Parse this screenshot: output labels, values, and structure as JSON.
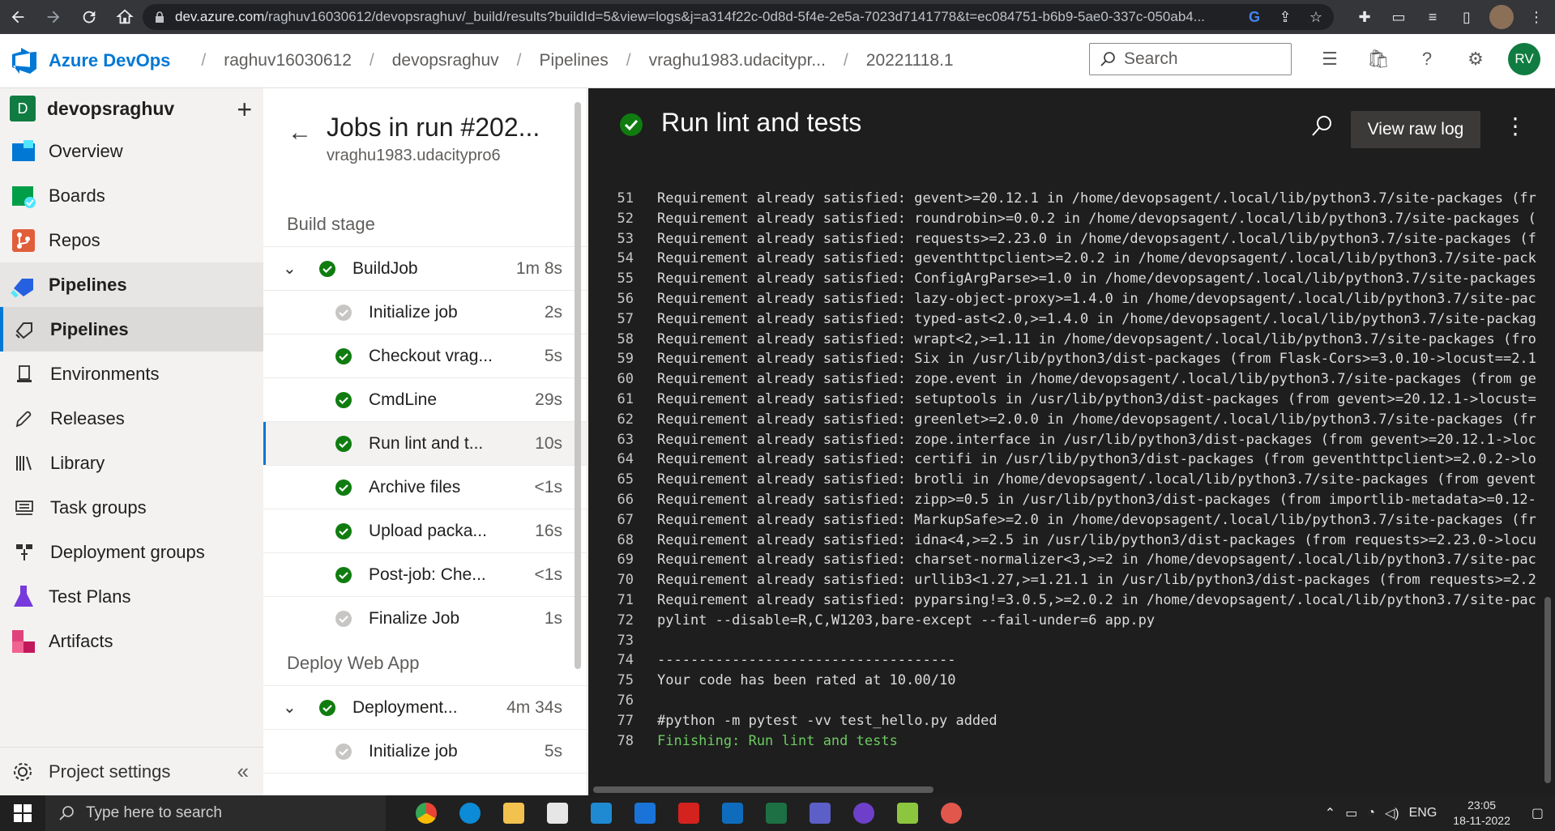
{
  "browser": {
    "url_host": "dev.azure.com",
    "url_rest": "/raghuv16030612/devopsraghuv/_build/results?buildId=5&view=logs&j=a314f22c-0d8d-5f4e-2e5a-7023d7141778&t=ec084751-b6b9-5ae0-337c-050ab4..."
  },
  "header": {
    "brand": "Azure DevOps",
    "breadcrumbs": [
      "raghuv16030612",
      "devopsraghuv",
      "Pipelines",
      "vraghu1983.udacitypr...",
      "20221118.1"
    ],
    "search_placeholder": "Search",
    "avatar_initials": "RV"
  },
  "sidebar": {
    "project_initial": "D",
    "project_name": "devopsraghuv",
    "items": [
      {
        "label": "Overview",
        "icon": "overview-icon"
      },
      {
        "label": "Boards",
        "icon": "boards-icon"
      },
      {
        "label": "Repos",
        "icon": "repos-icon"
      },
      {
        "label": "Pipelines",
        "icon": "pipelines-icon"
      }
    ],
    "subitems": [
      {
        "label": "Pipelines",
        "icon": "pipelines-sub-icon"
      },
      {
        "label": "Environments",
        "icon": "environments-icon"
      },
      {
        "label": "Releases",
        "icon": "releases-icon"
      },
      {
        "label": "Library",
        "icon": "library-icon"
      },
      {
        "label": "Task groups",
        "icon": "task-groups-icon"
      },
      {
        "label": "Deployment groups",
        "icon": "deployment-groups-icon"
      }
    ],
    "items2": [
      {
        "label": "Test Plans",
        "icon": "test-plans-icon"
      },
      {
        "label": "Artifacts",
        "icon": "artifacts-icon"
      }
    ],
    "footer": "Project settings"
  },
  "jobs": {
    "title": "Jobs in run #202...",
    "subtitle": "vraghu1983.udacitypro6",
    "stage1": "Build stage",
    "job1": {
      "name": "BuildJob",
      "duration": "1m 8s"
    },
    "steps1": [
      {
        "name": "Initialize job",
        "duration": "2s",
        "status": "skipped"
      },
      {
        "name": "Checkout vrag...",
        "duration": "5s",
        "status": "success"
      },
      {
        "name": "CmdLine",
        "duration": "29s",
        "status": "success"
      },
      {
        "name": "Run lint and t...",
        "duration": "10s",
        "status": "success"
      },
      {
        "name": "Archive files",
        "duration": "<1s",
        "status": "success"
      },
      {
        "name": "Upload packa...",
        "duration": "16s",
        "status": "success"
      },
      {
        "name": "Post-job: Che...",
        "duration": "<1s",
        "status": "success"
      },
      {
        "name": "Finalize Job",
        "duration": "1s",
        "status": "skipped"
      }
    ],
    "stage2": "Deploy Web App",
    "job2": {
      "name": "Deployment...",
      "duration": "4m 34s"
    },
    "steps2": [
      {
        "name": "Initialize job",
        "duration": "5s",
        "status": "skipped"
      }
    ]
  },
  "log": {
    "title": "Run lint and tests",
    "raw_button": "View raw log",
    "lines": [
      {
        "n": "51",
        "t": "Requirement already satisfied: gevent>=20.12.1 in /home/devopsagent/.local/lib/python3.7/site-packages (fr"
      },
      {
        "n": "52",
        "t": "Requirement already satisfied: roundrobin>=0.0.2 in /home/devopsagent/.local/lib/python3.7/site-packages ("
      },
      {
        "n": "53",
        "t": "Requirement already satisfied: requests>=2.23.0 in /home/devopsagent/.local/lib/python3.7/site-packages (f"
      },
      {
        "n": "54",
        "t": "Requirement already satisfied: geventhttpclient>=2.0.2 in /home/devopsagent/.local/lib/python3.7/site-pack"
      },
      {
        "n": "55",
        "t": "Requirement already satisfied: ConfigArgParse>=1.0 in /home/devopsagent/.local/lib/python3.7/site-packages"
      },
      {
        "n": "56",
        "t": "Requirement already satisfied: lazy-object-proxy>=1.4.0 in /home/devopsagent/.local/lib/python3.7/site-pac"
      },
      {
        "n": "57",
        "t": "Requirement already satisfied: typed-ast<2.0,>=1.4.0 in /home/devopsagent/.local/lib/python3.7/site-packag"
      },
      {
        "n": "58",
        "t": "Requirement already satisfied: wrapt<2,>=1.11 in /home/devopsagent/.local/lib/python3.7/site-packages (fro"
      },
      {
        "n": "59",
        "t": "Requirement already satisfied: Six in /usr/lib/python3/dist-packages (from Flask-Cors>=3.0.10->locust==2.1"
      },
      {
        "n": "60",
        "t": "Requirement already satisfied: zope.event in /home/devopsagent/.local/lib/python3.7/site-packages (from ge"
      },
      {
        "n": "61",
        "t": "Requirement already satisfied: setuptools in /usr/lib/python3/dist-packages (from gevent>=20.12.1->locust="
      },
      {
        "n": "62",
        "t": "Requirement already satisfied: greenlet>=2.0.0 in /home/devopsagent/.local/lib/python3.7/site-packages (fr"
      },
      {
        "n": "63",
        "t": "Requirement already satisfied: zope.interface in /usr/lib/python3/dist-packages (from gevent>=20.12.1->loc"
      },
      {
        "n": "64",
        "t": "Requirement already satisfied: certifi in /usr/lib/python3/dist-packages (from geventhttpclient>=2.0.2->lo"
      },
      {
        "n": "65",
        "t": "Requirement already satisfied: brotli in /home/devopsagent/.local/lib/python3.7/site-packages (from gevent"
      },
      {
        "n": "66",
        "t": "Requirement already satisfied: zipp>=0.5 in /usr/lib/python3/dist-packages (from importlib-metadata>=0.12-"
      },
      {
        "n": "67",
        "t": "Requirement already satisfied: MarkupSafe>=2.0 in /home/devopsagent/.local/lib/python3.7/site-packages (fr"
      },
      {
        "n": "68",
        "t": "Requirement already satisfied: idna<4,>=2.5 in /usr/lib/python3/dist-packages (from requests>=2.23.0->locu"
      },
      {
        "n": "69",
        "t": "Requirement already satisfied: charset-normalizer<3,>=2 in /home/devopsagent/.local/lib/python3.7/site-pac"
      },
      {
        "n": "70",
        "t": "Requirement already satisfied: urllib3<1.27,>=1.21.1 in /usr/lib/python3/dist-packages (from requests>=2.2"
      },
      {
        "n": "71",
        "t": "Requirement already satisfied: pyparsing!=3.0.5,>=2.0.2 in /home/devopsagent/.local/lib/python3.7/site-pac"
      },
      {
        "n": "72",
        "t": "pylint --disable=R,C,W1203,bare-except --fail-under=6  app.py"
      },
      {
        "n": "73",
        "t": ""
      },
      {
        "n": "74",
        "t": "------------------------------------"
      },
      {
        "n": "75",
        "t": "Your code has been rated at 10.00/10"
      },
      {
        "n": "76",
        "t": ""
      },
      {
        "n": "77",
        "t": "#python -m pytest -vv test_hello.py added"
      },
      {
        "n": "78",
        "t": "Finishing: Run lint and tests",
        "green": true
      }
    ]
  },
  "taskbar": {
    "search_placeholder": "Type here to search",
    "lang": "ENG",
    "time": "23:05",
    "date": "18-11-2022"
  },
  "colors": {
    "accent": "#0078d4",
    "success": "#107c10",
    "log_bg": "#1e1e1e"
  }
}
